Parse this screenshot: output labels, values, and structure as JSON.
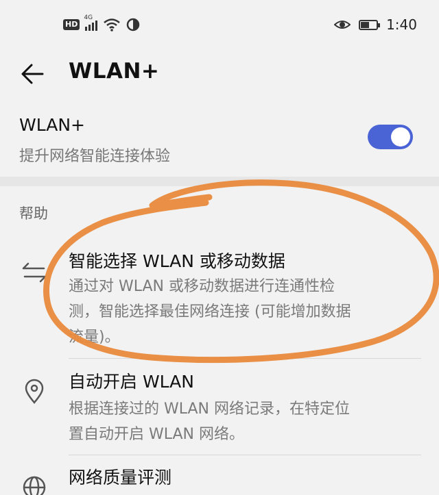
{
  "status_bar": {
    "hd_badge": "HD",
    "network_type": "4G",
    "time": "1:40",
    "battery_fraction": 0.55
  },
  "header": {
    "title": "WLAN+"
  },
  "wlan_plus": {
    "title": "WLAN+",
    "subtitle": "提升网络智能连接体验",
    "enabled": true,
    "accent_color": "#4a64d6"
  },
  "help": {
    "section_label": "帮助",
    "items": [
      {
        "icon": "swap-arrows-icon",
        "title": "智能选择 WLAN 或移动数据",
        "desc_lines": [
          "通过对 WLAN 或移动数据进行连通性检",
          "测，智能选择最佳网络连接 (可能增加数据",
          "流量)。"
        ]
      },
      {
        "icon": "location-pin-icon",
        "title": "自动开启 WLAN",
        "desc_lines": [
          "根据连接过的 WLAN 网络记录，在特定位",
          "置自动开启 WLAN 网络。"
        ]
      },
      {
        "icon": "globe-icon",
        "title": "网络质量评测",
        "desc_lines": []
      }
    ]
  },
  "annotation": {
    "color": "#e98a3c"
  }
}
